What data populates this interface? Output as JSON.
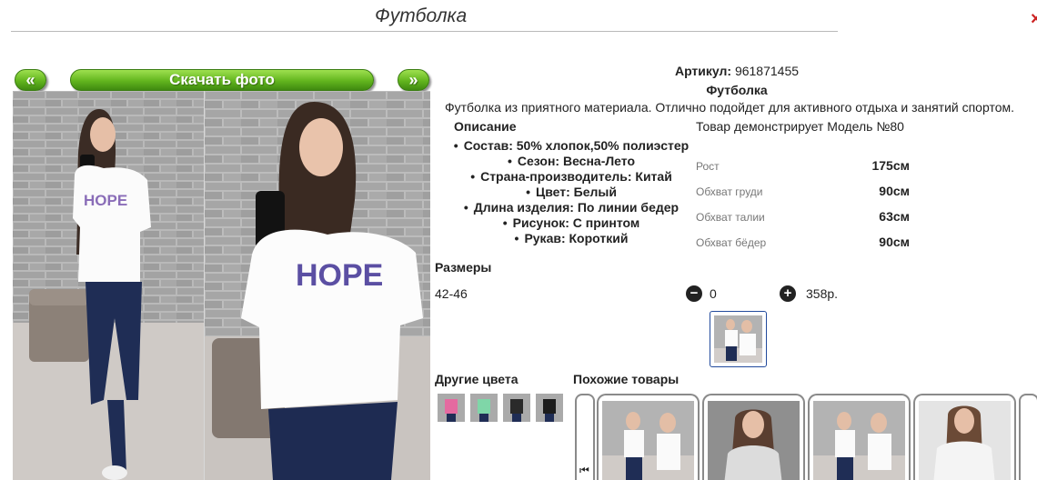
{
  "header": {
    "title": "Футболка"
  },
  "controls": {
    "prev_label": "«",
    "download_label": "Скачать фото",
    "next_label": "»"
  },
  "product": {
    "article_label": "Артикул:",
    "article_value": "961871455",
    "name": "Футболка",
    "description": "Футболка из приятного материала. Отлично подойдет для активного отдыха и занятий спортом."
  },
  "details": {
    "heading": "Описание",
    "attributes": [
      "Состав: 50% хлопок,50% полиэстер",
      "Сезон: Весна-Лето",
      "Страна-производитель: Китай",
      "Цвет: Белый",
      "Длина изделия: По линии бедер",
      "Рисунок: С принтом",
      "Рукав: Короткий"
    ]
  },
  "model": {
    "title": "Товар демонстрирует Модель №80",
    "measurements": [
      {
        "label": "Рост",
        "value": "175см"
      },
      {
        "label": "Обхват груди",
        "value": "90см"
      },
      {
        "label": "Обхват талии",
        "value": "63см"
      },
      {
        "label": "Обхват бёдер",
        "value": "90см"
      }
    ]
  },
  "sizes": {
    "heading": "Размеры",
    "rows": [
      {
        "size": "42-46",
        "quantity": "0",
        "price": "358р."
      }
    ]
  },
  "other_colors": {
    "heading": "Другие цвета",
    "swatches": [
      "#e46aa0",
      "#7fd6a8",
      "#2a2a2a",
      "#1c1c1c"
    ]
  },
  "similar": {
    "heading": "Похожие товары"
  },
  "print": {
    "text": "HOPE"
  },
  "icons": {
    "minus": "minus-circle-icon",
    "plus": "plus-circle-icon",
    "prev": "carousel-prev-icon",
    "close": "close-icon"
  }
}
